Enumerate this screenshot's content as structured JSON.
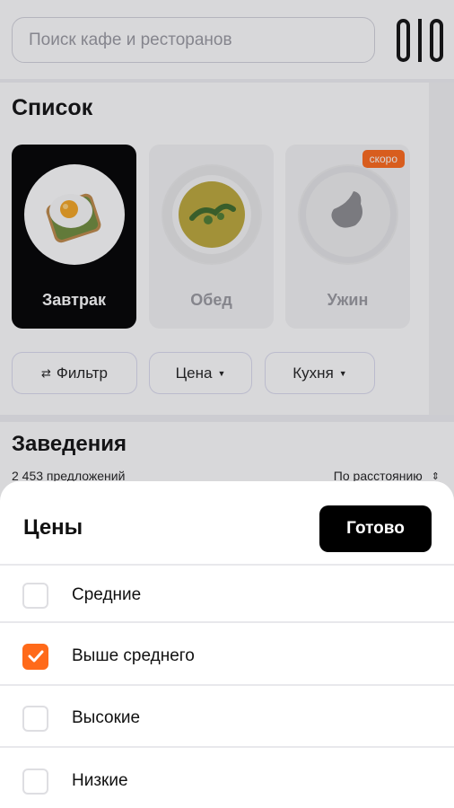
{
  "search": {
    "placeholder": "Поиск кафе и ресторанов"
  },
  "list": {
    "title": "Список",
    "categories": [
      {
        "label": "Завтрак",
        "active": true
      },
      {
        "label": "Обед",
        "active": false
      },
      {
        "label": "Ужин",
        "active": false,
        "badge": "скоро"
      }
    ],
    "filters": [
      {
        "label": "Фильтр",
        "icon": "filter-sliders-icon"
      },
      {
        "label": "Цена",
        "icon": "caret-down-icon"
      },
      {
        "label": "Кухня",
        "icon": "caret-down-icon"
      }
    ]
  },
  "places": {
    "title": "Заведения",
    "count": "2 453 предложений",
    "sort_label": "По расстоянию",
    "sort_icon": "sort-arrows-icon"
  },
  "sheet": {
    "title": "Цены",
    "done_label": "Готово",
    "options": [
      {
        "label": "Средние",
        "checked": false
      },
      {
        "label": "Выше среднего",
        "checked": true
      },
      {
        "label": "Высокие",
        "checked": false
      },
      {
        "label": "Низкие",
        "checked": false
      }
    ]
  },
  "colors": {
    "accent": "#ff6a1a",
    "active_card": "#000000",
    "button_bg": "#000000"
  }
}
